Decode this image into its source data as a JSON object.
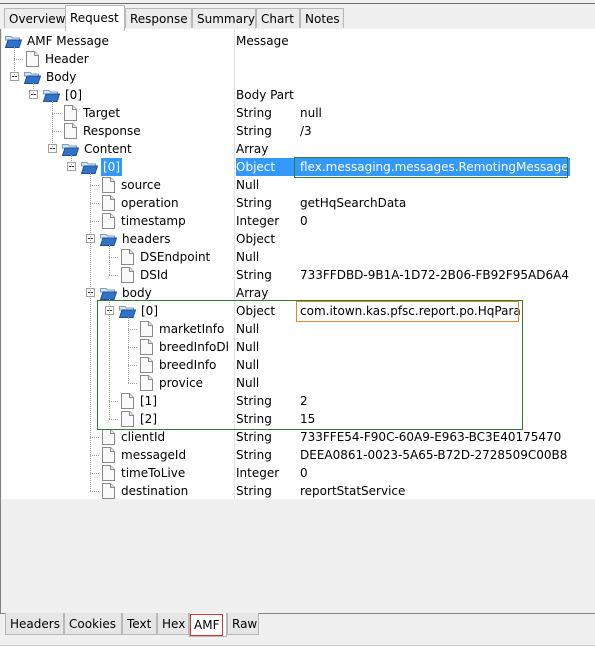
{
  "top_tabs": [
    {
      "label": "Overview",
      "active": false
    },
    {
      "label": "Request",
      "active": true
    },
    {
      "label": "Response",
      "active": false
    },
    {
      "label": "Summary",
      "active": false
    },
    {
      "label": "Chart",
      "active": false
    },
    {
      "label": "Notes",
      "active": false
    }
  ],
  "tree": {
    "rows": [
      {
        "name": "AMF Message",
        "type": "Message",
        "value": "",
        "icon": "folder-open-icon",
        "depth": 0,
        "expandable": false
      },
      {
        "name": "Header",
        "type": "",
        "value": "",
        "icon": "file-icon",
        "depth": 1,
        "expandable": false
      },
      {
        "name": "Body",
        "type": "",
        "value": "",
        "icon": "folder-open-icon",
        "depth": 1,
        "expandable": true
      },
      {
        "name": "[0]",
        "type": "Body Part",
        "value": "",
        "icon": "folder-open-icon",
        "depth": 2,
        "expandable": true
      },
      {
        "name": "Target",
        "type": "String",
        "value": "null",
        "icon": "file-icon",
        "depth": 3,
        "expandable": false
      },
      {
        "name": "Response",
        "type": "String",
        "value": "/3",
        "icon": "file-icon",
        "depth": 3,
        "expandable": false
      },
      {
        "name": "Content",
        "type": "Array",
        "value": "",
        "icon": "folder-open-icon",
        "depth": 3,
        "expandable": true
      },
      {
        "name": "[0]",
        "type": "Object",
        "value": "flex.messaging.messages.RemotingMessage",
        "icon": "folder-open-icon",
        "depth": 4,
        "expandable": true,
        "selected": true
      },
      {
        "name": "source",
        "type": "Null",
        "value": "",
        "icon": "file-icon",
        "depth": 5,
        "expandable": false
      },
      {
        "name": "operation",
        "type": "String",
        "value": "getHqSearchData",
        "icon": "file-icon",
        "depth": 5,
        "expandable": false
      },
      {
        "name": "timestamp",
        "type": "Integer",
        "value": "0",
        "icon": "file-icon",
        "depth": 5,
        "expandable": false
      },
      {
        "name": "headers",
        "type": "Object",
        "value": "",
        "icon": "folder-open-icon",
        "depth": 5,
        "expandable": true
      },
      {
        "name": "DSEndpoint",
        "type": "Null",
        "value": "",
        "icon": "file-icon",
        "depth": 6,
        "expandable": false
      },
      {
        "name": "DSId",
        "type": "String",
        "value": "733FFDBD-9B1A-1D72-2B06-FB92F95AD6A4",
        "icon": "file-icon",
        "depth": 6,
        "expandable": false
      },
      {
        "name": "body",
        "type": "Array",
        "value": "",
        "icon": "folder-open-icon",
        "depth": 5,
        "expandable": true
      },
      {
        "name": "[0]",
        "type": "Object",
        "value": "com.itown.kas.pfsc.report.po.HqPara",
        "icon": "folder-open-icon",
        "depth": 6,
        "expandable": true
      },
      {
        "name": "marketInfo",
        "type": "Null",
        "value": "",
        "icon": "file-icon",
        "depth": 7,
        "expandable": false
      },
      {
        "name": "breedInfoDl",
        "type": "Null",
        "value": "",
        "icon": "file-icon",
        "depth": 7,
        "expandable": false
      },
      {
        "name": "breedInfo",
        "type": "Null",
        "value": "",
        "icon": "file-icon",
        "depth": 7,
        "expandable": false
      },
      {
        "name": "provice",
        "type": "Null",
        "value": "",
        "icon": "file-icon",
        "depth": 7,
        "expandable": false
      },
      {
        "name": "[1]",
        "type": "String",
        "value": "2",
        "icon": "file-icon",
        "depth": 6,
        "expandable": false
      },
      {
        "name": "[2]",
        "type": "String",
        "value": "15",
        "icon": "file-icon",
        "depth": 6,
        "expandable": false
      },
      {
        "name": "clientId",
        "type": "String",
        "value": "733FFE54-F90C-60A9-E963-BC3E40175470",
        "icon": "file-icon",
        "depth": 5,
        "expandable": false
      },
      {
        "name": "messageId",
        "type": "String",
        "value": "DEEA0861-0023-5A65-B72D-2728509C00B8",
        "icon": "file-icon",
        "depth": 5,
        "expandable": false
      },
      {
        "name": "timeToLive",
        "type": "Integer",
        "value": "0",
        "icon": "file-icon",
        "depth": 5,
        "expandable": false
      },
      {
        "name": "destination",
        "type": "String",
        "value": "reportStatService",
        "icon": "file-icon",
        "depth": 5,
        "expandable": false
      }
    ]
  },
  "bottom_tabs": [
    {
      "label": "Headers",
      "active": false
    },
    {
      "label": "Cookies",
      "active": false
    },
    {
      "label": "Text",
      "active": false
    },
    {
      "label": "Hex",
      "active": false
    },
    {
      "label": "AMF",
      "active": true
    },
    {
      "label": "Raw",
      "active": false
    }
  ],
  "colors": {
    "selection": "#3399ff",
    "highlight_green": "#2e7d32",
    "highlight_orange": "#e08a2c",
    "highlight_red": "#e03030"
  }
}
